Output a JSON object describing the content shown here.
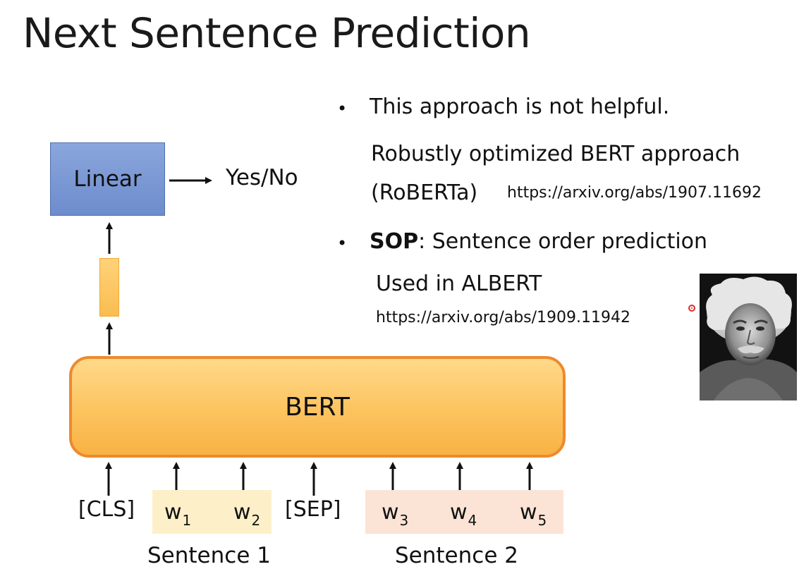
{
  "slide": {
    "title": "Next Sentence Prediction"
  },
  "diagram": {
    "linear_label": "Linear",
    "output_label": "Yes/No",
    "bert_label": "BERT",
    "tokens": {
      "cls": "[CLS]",
      "w1": {
        "base": "w",
        "sub": "1"
      },
      "w2": {
        "base": "w",
        "sub": "2"
      },
      "sep": "[SEP]",
      "w3": {
        "base": "w",
        "sub": "3"
      },
      "w4": {
        "base": "w",
        "sub": "4"
      },
      "w5": {
        "base": "w",
        "sub": "5"
      }
    },
    "sentence1_label": "Sentence 1",
    "sentence2_label": "Sentence 2",
    "colors": {
      "linear_fill": "#7b98d6",
      "bert_fill": "#fcc35e",
      "bert_border": "#ee8a2c",
      "sentence1_bg": "#fdf0c9",
      "sentence2_bg": "#fbe4d6"
    }
  },
  "notes": {
    "bullet1": {
      "text": "This approach is not helpful.",
      "line2": "Robustly optimized BERT approach",
      "line3_name": "(RoBERTa)",
      "line3_url": "https://arxiv.org/abs/1907.11692"
    },
    "bullet2": {
      "bold": "SOP",
      "rest": ": Sentence order prediction",
      "line2": "Used in ALBERT",
      "line3_url": "https://arxiv.org/abs/1909.11942"
    }
  },
  "photo": {
    "icon": "portrait-photo"
  },
  "pointer": {
    "icon": "laser-pointer-dot",
    "color": "#e02a2a"
  }
}
